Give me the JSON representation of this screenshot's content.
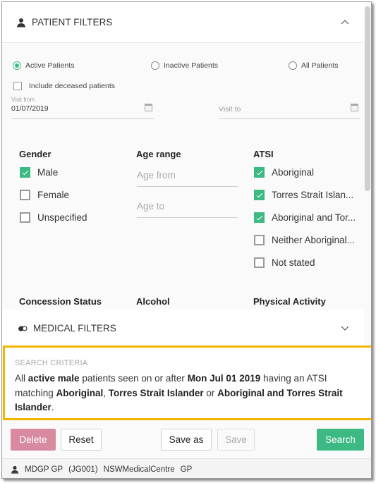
{
  "patient_filters": {
    "title": "PATIENT FILTERS",
    "icon": "person-icon",
    "collapse_icon": "chevron-up-icon",
    "status_options": [
      {
        "label": "Active Patients",
        "selected": true
      },
      {
        "label": "Inactive Patients",
        "selected": false
      },
      {
        "label": "All Patients",
        "selected": false
      }
    ],
    "include_deceased": {
      "label": "Include deceased patients",
      "checked": false
    },
    "visit_from": {
      "label": "Visit from",
      "value": "01/07/2019",
      "icon": "calendar-icon"
    },
    "visit_to": {
      "placeholder": "Visit to",
      "value": "",
      "icon": "calendar-icon"
    },
    "gender": {
      "title": "Gender",
      "options": [
        {
          "label": "Male",
          "checked": true
        },
        {
          "label": "Female",
          "checked": false
        },
        {
          "label": "Unspecified",
          "checked": false
        }
      ]
    },
    "age_range": {
      "title": "Age range",
      "from_placeholder": "Age from",
      "to_placeholder": "Age to"
    },
    "atsi": {
      "title": "ATSI",
      "options": [
        {
          "label": "Aboriginal",
          "checked": true
        },
        {
          "label": "Torres Strait Islan...",
          "checked": true
        },
        {
          "label": "Aboriginal and Tor...",
          "checked": true
        },
        {
          "label": "Neither Aboriginal...",
          "checked": false
        },
        {
          "label": "Not stated",
          "checked": false
        }
      ]
    },
    "more_sections": [
      "Concession Status",
      "Alcohol",
      "Physical Activity"
    ]
  },
  "medical_filters": {
    "title": "MEDICAL FILTERS",
    "icon": "pills-icon",
    "expand_icon": "chevron-down-icon"
  },
  "search_criteria": {
    "title": "SEARCH CRITERIA",
    "parts": [
      {
        "text": "All ",
        "bold": false
      },
      {
        "text": "active male",
        "bold": true
      },
      {
        "text": " patients seen on or after ",
        "bold": false
      },
      {
        "text": "Mon Jul 01 2019",
        "bold": true
      },
      {
        "text": " having an ATSI matching ",
        "bold": false
      },
      {
        "text": "Aboriginal",
        "bold": true
      },
      {
        "text": ", ",
        "bold": false
      },
      {
        "text": "Torres Strait Islander",
        "bold": true
      },
      {
        "text": " or ",
        "bold": false
      },
      {
        "text": "Aboriginal and Torres Strait Islander",
        "bold": true
      },
      {
        "text": ".",
        "bold": false
      }
    ],
    "highlight_color": "#f5b400"
  },
  "actions": {
    "delete": "Delete",
    "reset": "Reset",
    "save_as": "Save as",
    "save": "Save",
    "search": "Search"
  },
  "footer": {
    "icon": "person-icon",
    "user": "MDGP GP",
    "code": "(JG001)",
    "centre": "NSWMedicalCentre",
    "role": "GP"
  },
  "colors": {
    "accent": "#3dba84",
    "delete": "#d78aa0",
    "highlight": "#f5b400"
  }
}
